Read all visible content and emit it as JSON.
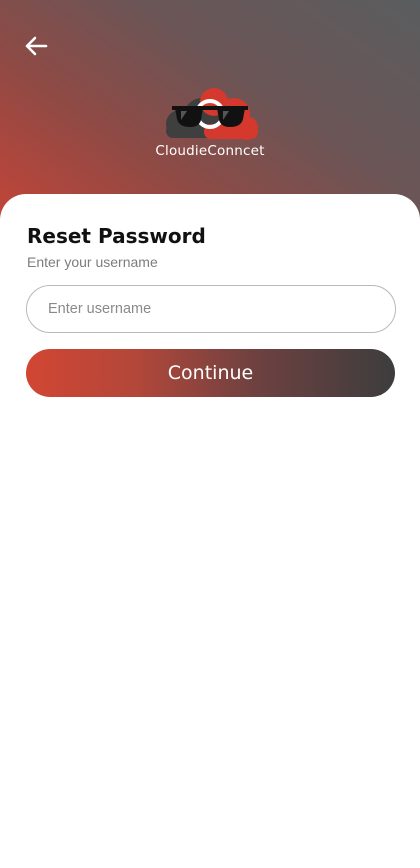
{
  "header": {
    "back_icon": "arrow-left-icon",
    "logo_icon": "cloud-sunglasses-logo-icon",
    "brand_name": "CloudieConncet",
    "gradient_colors": [
      "#c84436",
      "#5a5d5f"
    ]
  },
  "form": {
    "title": "Reset Password",
    "subtitle": "Enter your username",
    "username_placeholder": "Enter username",
    "username_value": "",
    "continue_label": "Continue",
    "button_gradient": [
      "#d24633",
      "#3d3d3d"
    ]
  }
}
